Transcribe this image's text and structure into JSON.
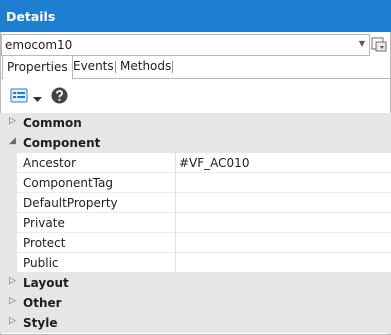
{
  "window": {
    "title": "Details"
  },
  "object_selector": {
    "value": "emocom10"
  },
  "tabs": [
    {
      "label": "Properties",
      "active": true
    },
    {
      "label": "Events",
      "active": false
    },
    {
      "label": "Methods",
      "active": false
    }
  ],
  "toolbar": {
    "view_icon": "categorized-view-icon",
    "dropdown_icon": "chevron-down-icon",
    "help_icon": "help-icon"
  },
  "categories": {
    "common": "Common",
    "component": "Component",
    "layout": "Layout",
    "other": "Other",
    "style": "Style"
  },
  "properties": [
    {
      "name": "Ancestor",
      "value": "#VF_AC010"
    },
    {
      "name": "ComponentTag",
      "value": ""
    },
    {
      "name": "DefaultProperty",
      "value": ""
    },
    {
      "name": "Private",
      "value": ""
    },
    {
      "name": "Protect",
      "value": ""
    },
    {
      "name": "Public",
      "value": ""
    }
  ],
  "colors": {
    "title_bar": "#1e7fd0",
    "category_bg": "#e6e6e6"
  }
}
